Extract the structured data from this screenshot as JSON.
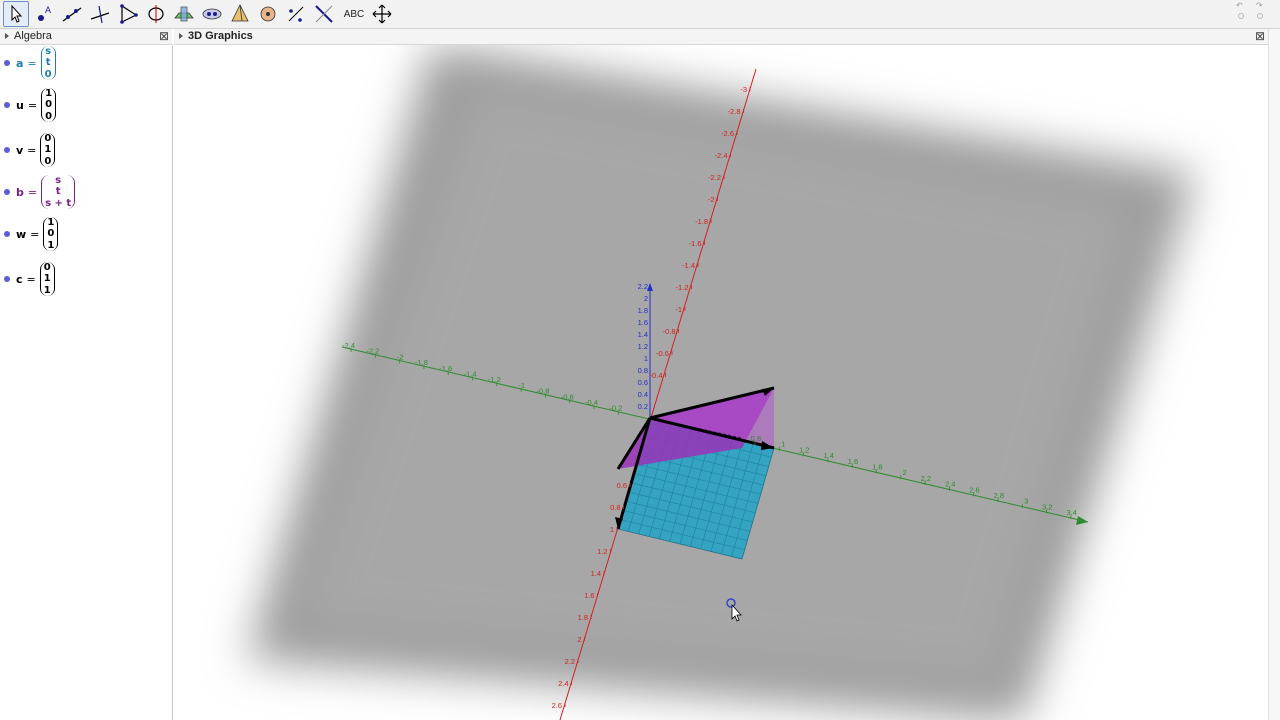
{
  "toolbar": {
    "tools": [
      "move-tool",
      "point-tool",
      "line-tool",
      "perpendicular-line-tool",
      "polygon-tool",
      "circle-tool",
      "intersect-tool",
      "sphere-tool",
      "pyramid-tool",
      "rotate-tool",
      "reflect-tool",
      "view-tool",
      "text-tool",
      "move-view-tool"
    ],
    "text_tool_label": "ABC"
  },
  "algebra": {
    "title": "Algebra",
    "items": [
      {
        "name": "a",
        "eq": "=",
        "comps": [
          "s",
          "t",
          "0"
        ],
        "color": "#1e7ea8"
      },
      {
        "name": "u",
        "eq": "=",
        "comps": [
          "1",
          "0",
          "0"
        ],
        "color": "#000000"
      },
      {
        "name": "v",
        "eq": "=",
        "comps": [
          "0",
          "1",
          "0"
        ],
        "color": "#000000"
      },
      {
        "name": "b",
        "eq": "=",
        "comps": [
          "s",
          "t",
          "s + t"
        ],
        "color": "#7a1f86"
      },
      {
        "name": "w",
        "eq": "=",
        "comps": [
          "1",
          "0",
          "1"
        ],
        "color": "#000000"
      },
      {
        "name": "c",
        "eq": "=",
        "comps": [
          "0",
          "1",
          "1"
        ],
        "color": "#000000"
      }
    ]
  },
  "graphics": {
    "title": "3D Graphics",
    "x_ticks": [
      "-2.4",
      "-2.2",
      "-2",
      "-1.8",
      "-1.6",
      "-1.4",
      "-1.2",
      "-1",
      "-0.8",
      "-0.6",
      "-0.4",
      "-0.2",
      "0.8",
      "1",
      "1.2",
      "1.4",
      "1.6",
      "1.8",
      "2",
      "2.2",
      "2.4",
      "2.6",
      "2.8",
      "3",
      "3.2",
      "3.4"
    ],
    "y_ticks": [
      "-3",
      "-2.8",
      "-2.6",
      "-2.4",
      "-2.2",
      "-2",
      "-1.8",
      "-1.6",
      "-1.4",
      "-1.2",
      "-1",
      "-0.8",
      "-0.6",
      "-0.4",
      "0.6",
      "0.8",
      "1",
      "1.2",
      "1.4",
      "1.6",
      "1.8",
      "2",
      "2.2",
      "2.4",
      "2.6"
    ],
    "z_ticks": [
      "2.2",
      "2",
      "1.8",
      "1.6",
      "1.4",
      "1.2",
      "1",
      "0.8",
      "0.6",
      "0.4",
      "0.2"
    ],
    "colors": {
      "x_axis": "#2e8b2e",
      "y_axis": "#d42020",
      "z_axis": "#2030c8",
      "plane_a": "#2fa3c4",
      "plane_b": "#9a33b8"
    }
  }
}
